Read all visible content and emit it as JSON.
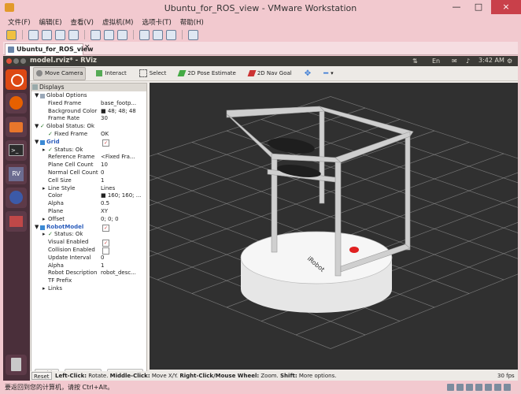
{
  "vmware": {
    "title": "Ubuntu_for_ROS_view - VMware Workstation",
    "menu": [
      "文件(F)",
      "编辑(E)",
      "查看(V)",
      "虚拟机(M)",
      "选项卡(T)",
      "帮助(H)"
    ],
    "tab_label": "Ubuntu_for_ROS_view",
    "tab_close": "×",
    "status_text": "要返回到您的计算机，请按 Ctrl+Alt。",
    "window_buttons": [
      "—",
      "□",
      "×"
    ]
  },
  "ubuntu": {
    "window_title": "model.rviz* - RViz",
    "clock": "3:42 AM"
  },
  "rviz": {
    "tools": [
      "Move Camera",
      "Interact",
      "Select",
      "2D Pose Estimate",
      "2D Nav Goal"
    ],
    "displays_title": "Displays",
    "tree": [
      {
        "k": "Global Options",
        "v": "",
        "indent": 1,
        "arrow": "▼",
        "blue": false
      },
      {
        "k": "Fixed Frame",
        "v": "base_footp...",
        "indent": 2
      },
      {
        "k": "Background Color",
        "v": "■ 48; 48; 48",
        "indent": 2
      },
      {
        "k": "Frame Rate",
        "v": "30",
        "indent": 2
      },
      {
        "k": "Global Status: Ok",
        "v": "",
        "indent": 1,
        "arrow": "▼",
        "check": "✓"
      },
      {
        "k": "Fixed Frame",
        "v": "OK",
        "indent": 2,
        "check": "✓"
      },
      {
        "k": "Grid",
        "v": "",
        "indent": 1,
        "arrow": "▼",
        "blue": true,
        "box": true
      },
      {
        "k": "Status: Ok",
        "v": "",
        "indent": 2,
        "arrow": "▸",
        "check": "✓"
      },
      {
        "k": "Reference Frame",
        "v": "<Fixed Fra...",
        "indent": 2
      },
      {
        "k": "Plane Cell Count",
        "v": "10",
        "indent": 2
      },
      {
        "k": "Normal Cell Count",
        "v": "0",
        "indent": 2
      },
      {
        "k": "Cell Size",
        "v": "1",
        "indent": 2
      },
      {
        "k": "Line Style",
        "v": "Lines",
        "indent": 2,
        "arrow": "▸"
      },
      {
        "k": "Color",
        "v": "■ 160; 160; ...",
        "indent": 2
      },
      {
        "k": "Alpha",
        "v": "0.5",
        "indent": 2
      },
      {
        "k": "Plane",
        "v": "XY",
        "indent": 2
      },
      {
        "k": "Offset",
        "v": "0; 0; 0",
        "indent": 2,
        "arrow": "▸"
      },
      {
        "k": "RobotModel",
        "v": "",
        "indent": 1,
        "arrow": "▼",
        "blue": true,
        "box": true
      },
      {
        "k": "Status: Ok",
        "v": "",
        "indent": 2,
        "arrow": "▸",
        "check": "✓"
      },
      {
        "k": "Visual Enabled",
        "v": "",
        "indent": 2,
        "box": true
      },
      {
        "k": "Collision Enabled",
        "v": "",
        "indent": 2,
        "boxEmpty": true
      },
      {
        "k": "Update Interval",
        "v": "0",
        "indent": 2
      },
      {
        "k": "Alpha",
        "v": "1",
        "indent": 2
      },
      {
        "k": "Robot Description",
        "v": "robot_desc...",
        "indent": 2
      },
      {
        "k": "TF Prefix",
        "v": "",
        "indent": 2
      },
      {
        "k": "Links",
        "v": "",
        "indent": 2,
        "arrow": "▸"
      }
    ],
    "buttons": {
      "add": "Add",
      "remove": "Remove",
      "rename": "Rename"
    },
    "status": {
      "reset": "Reset",
      "hint_parts": [
        {
          "b": "Left-Click:",
          "t": " Rotate. "
        },
        {
          "b": "Middle-Click:",
          "t": " Move X/Y. "
        },
        {
          "b": "Right-Click/Mouse Wheel:",
          "t": " Zoom. "
        },
        {
          "b": "Shift:",
          "t": " More options."
        }
      ],
      "fps": "30 fps"
    },
    "robot_label": "iRobot"
  },
  "colors": {
    "viewport_bg": "#303030",
    "grid": "#a0a0a0",
    "base": "#f0f0f0",
    "frame": "#dcdcdc",
    "bumper": "#e02020"
  }
}
